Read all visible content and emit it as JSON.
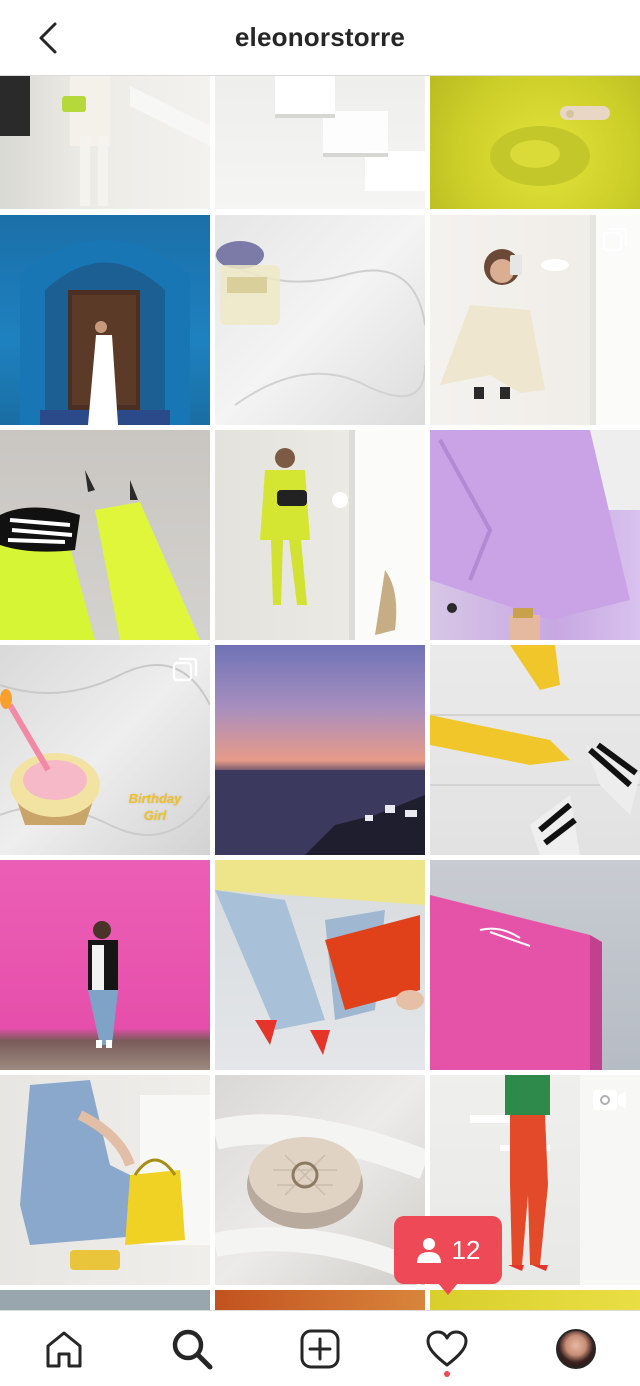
{
  "header": {
    "username": "eleonorstorre",
    "back_icon": "chevron-left-icon"
  },
  "grid": {
    "posts": [
      {
        "row": 1,
        "col": 1,
        "subject": "white suit lime bag",
        "badge": null
      },
      {
        "row": 1,
        "col": 2,
        "subject": "white floating stairs",
        "badge": null
      },
      {
        "row": 1,
        "col": 3,
        "subject": "lime knit sweater",
        "badge": null
      },
      {
        "row": 2,
        "col": 1,
        "subject": "blue arch doorway",
        "badge": null
      },
      {
        "row": 2,
        "col": 2,
        "subject": "perfume on marble",
        "badge": null
      },
      {
        "row": 2,
        "col": 3,
        "subject": "cream suit mirror selfie",
        "badge": "carousel-icon"
      },
      {
        "row": 3,
        "col": 1,
        "subject": "neon trousers zebra clutch",
        "badge": null
      },
      {
        "row": 3,
        "col": 2,
        "subject": "neon suit mirror selfie",
        "badge": null
      },
      {
        "row": 3,
        "col": 3,
        "subject": "lilac blazer",
        "badge": null
      },
      {
        "row": 4,
        "col": 1,
        "subject": "birthday cupcake",
        "badge": "carousel-icon",
        "overlay_text": [
          "Birthday",
          "Girl"
        ]
      },
      {
        "row": 4,
        "col": 2,
        "subject": "sunset over sea",
        "badge": null
      },
      {
        "row": 4,
        "col": 3,
        "subject": "yellow and zebra heels",
        "badge": null
      },
      {
        "row": 5,
        "col": 1,
        "subject": "pink wall",
        "badge": null
      },
      {
        "row": 5,
        "col": 2,
        "subject": "jeans and orange bag",
        "badge": null
      },
      {
        "row": 5,
        "col": 3,
        "subject": "pink building sky",
        "badge": null
      },
      {
        "row": 6,
        "col": 1,
        "subject": "blue dress yellow bag",
        "badge": null
      },
      {
        "row": 6,
        "col": 2,
        "subject": "cushion compact",
        "badge": null
      },
      {
        "row": 6,
        "col": 3,
        "subject": "red trousers",
        "badge": "video-icon"
      }
    ]
  },
  "notification": {
    "icon": "person-icon",
    "count": "12",
    "color": "#ed4956"
  },
  "bottom_nav": {
    "items": [
      {
        "name": "home",
        "icon": "home-icon"
      },
      {
        "name": "search",
        "icon": "search-icon",
        "active": true
      },
      {
        "name": "create",
        "icon": "add-post-icon"
      },
      {
        "name": "activity",
        "icon": "heart-icon",
        "has_dot": true
      },
      {
        "name": "profile",
        "icon": "avatar"
      }
    ]
  }
}
